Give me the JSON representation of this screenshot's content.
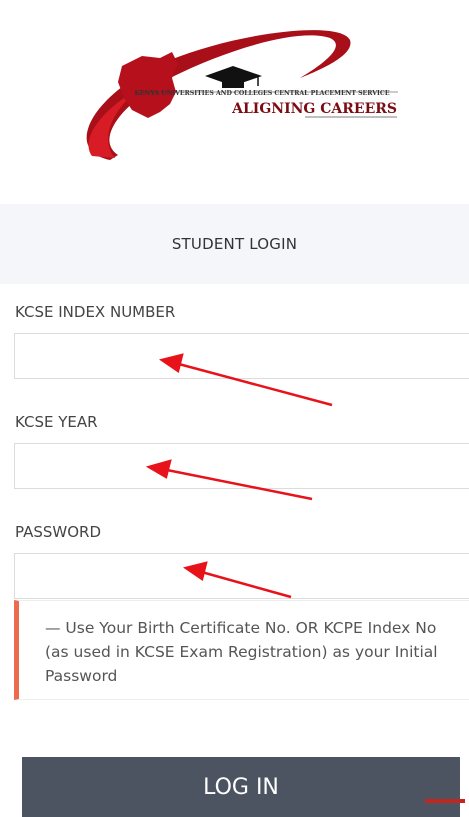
{
  "logo": {
    "org_name": "KENYA UNIVERSITIES AND COLLEGES CENTRAL PLACEMENT SERVICE",
    "tagline": "ALIGNING CAREERS",
    "colors": {
      "red": "#b5101b",
      "dark": "#1a1a1a"
    }
  },
  "header": {
    "title": "STUDENT LOGIN"
  },
  "form": {
    "index_label": "KCSE INDEX NUMBER",
    "index_value": "",
    "year_label": "KCSE YEAR",
    "year_value": "",
    "password_label": "PASSWORD",
    "password_value": "",
    "note": "— Use Your Birth Certificate No. OR KCPE Index No (as used in KCSE Exam Registration) as your Initial Password",
    "note_accent": "#ee6a4f",
    "submit_label": "LOG IN",
    "submit_bg": "#4b5460"
  },
  "annotations": {
    "arrow_color": "#e8121b",
    "icon": "red-arrow-icon"
  }
}
